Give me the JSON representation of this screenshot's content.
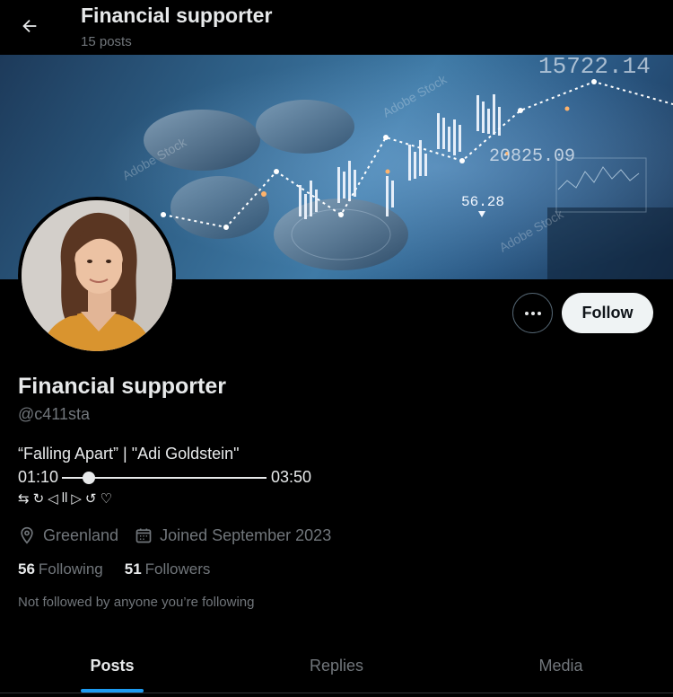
{
  "header": {
    "title": "Financial supporter",
    "posts_count": "15 posts"
  },
  "banner": {
    "numbers": [
      "15722.14",
      "20825.09",
      "56.28"
    ],
    "watermark": "Adobe Stock"
  },
  "actions": {
    "follow_label": "Follow"
  },
  "profile": {
    "name": "Financial supporter",
    "handle": "@c411sta",
    "bio_line": "“Falling Apart” | \"Adi Goldstein\"",
    "player": {
      "time_start": "01:10",
      "time_end": "03:50",
      "progress": 0.13,
      "controls": [
        "⇆",
        "↻",
        "◁",
        "ll",
        "▷",
        "↺",
        "♡"
      ]
    },
    "location": "Greenland",
    "joined": "Joined September 2023",
    "following_count": "56",
    "following_label": "Following",
    "followers_count": "51",
    "followers_label": "Followers",
    "not_followed_text": "Not followed by anyone you’re following"
  },
  "tabs": [
    {
      "label": "Posts",
      "active": true
    },
    {
      "label": "Replies",
      "active": false
    },
    {
      "label": "Media",
      "active": false
    }
  ],
  "colors": {
    "accent": "#1d9bf0",
    "background": "#000000",
    "muted": "#71767b"
  }
}
